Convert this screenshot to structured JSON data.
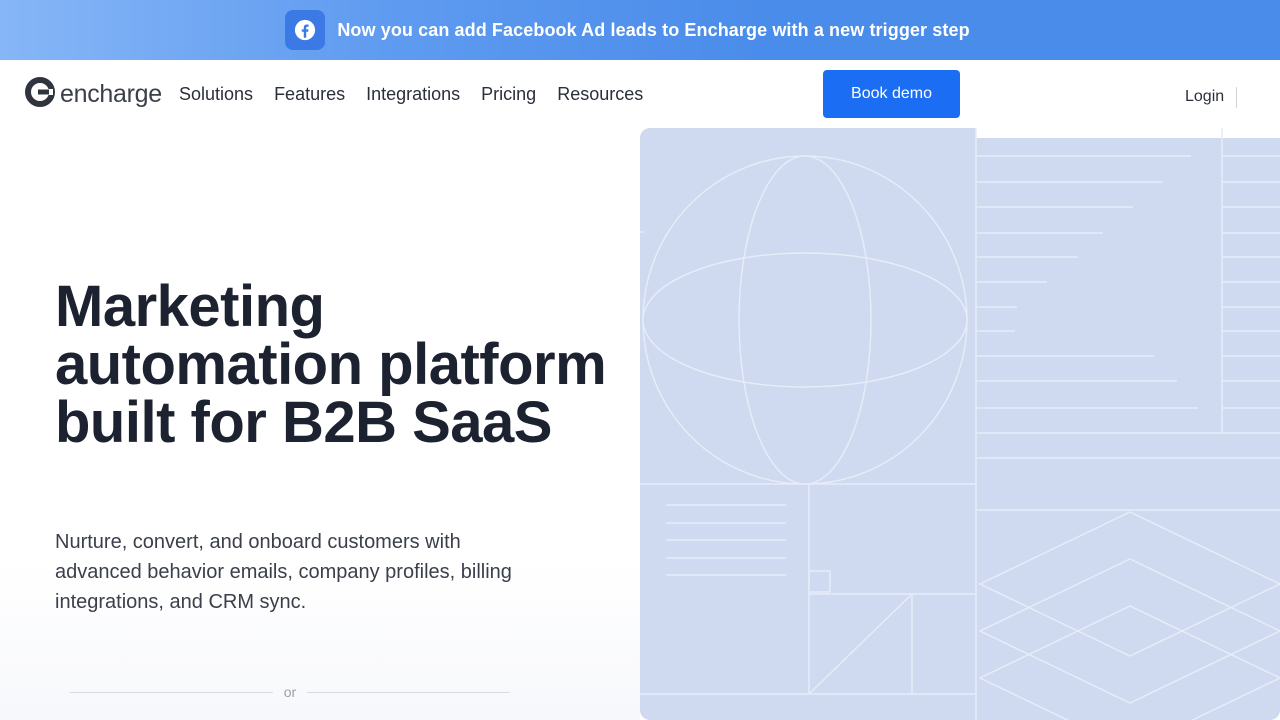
{
  "banner": {
    "icon": "facebook-icon",
    "text": "Now you can add Facebook Ad leads to Encharge with a new trigger step"
  },
  "nav": {
    "logo_text": "encharge",
    "links": [
      "Solutions",
      "Features",
      "Integrations",
      "Pricing",
      "Resources"
    ],
    "book_demo": "Book demo",
    "login": "Login"
  },
  "hero": {
    "headline": "Marketing automation platform built for B2B SaaS",
    "subtext": "Nurture, convert, and onboard customers with advanced behavior emails, company profiles, billing integrations, and CRM sync.",
    "divider_text": "or"
  },
  "colors": {
    "accent": "#1b6ef3",
    "banner": "#4a8cea",
    "illustration_bg": "#cfd9ef"
  }
}
